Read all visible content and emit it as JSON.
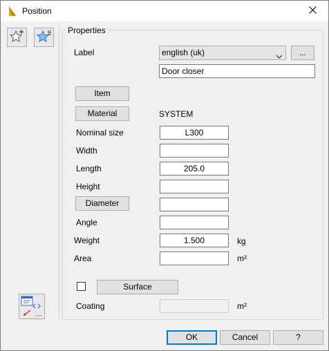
{
  "window": {
    "title": "Position"
  },
  "group": {
    "title": "Properties"
  },
  "label_row": {
    "label": "Label",
    "language": "english (uk)",
    "more_button": "...",
    "value": "Door closer"
  },
  "buttons": {
    "item": "Item",
    "material": "Material",
    "diameter": "Diameter",
    "surface": "Surface"
  },
  "material_value": "SYSTEM",
  "fields": {
    "nominal_size": {
      "label": "Nominal size",
      "value": "L300"
    },
    "width": {
      "label": "Width",
      "value": ""
    },
    "length": {
      "label": "Length",
      "value": "205.0"
    },
    "height": {
      "label": "Height",
      "value": ""
    },
    "diameter": {
      "value": ""
    },
    "angle": {
      "label": "Angle",
      "value": ""
    },
    "weight": {
      "label": "Weight",
      "value": "1.500",
      "unit": "kg"
    },
    "area": {
      "label": "Area",
      "value": "",
      "unit": "m²"
    },
    "coating": {
      "label": "Coating",
      "value": "",
      "unit": "m²"
    }
  },
  "surface_checked": false,
  "footer": {
    "ok": "OK",
    "cancel": "Cancel",
    "help": "?"
  },
  "icons": {
    "app": "app-logo-icon",
    "add_favorite": "star-add-icon",
    "favorites_list": "star-list-icon",
    "side": "code-view-icon",
    "close": "close-icon"
  },
  "colors": {
    "accent": "#0078d7",
    "star": "#4a90e2",
    "app_logo": "#e8a317"
  }
}
